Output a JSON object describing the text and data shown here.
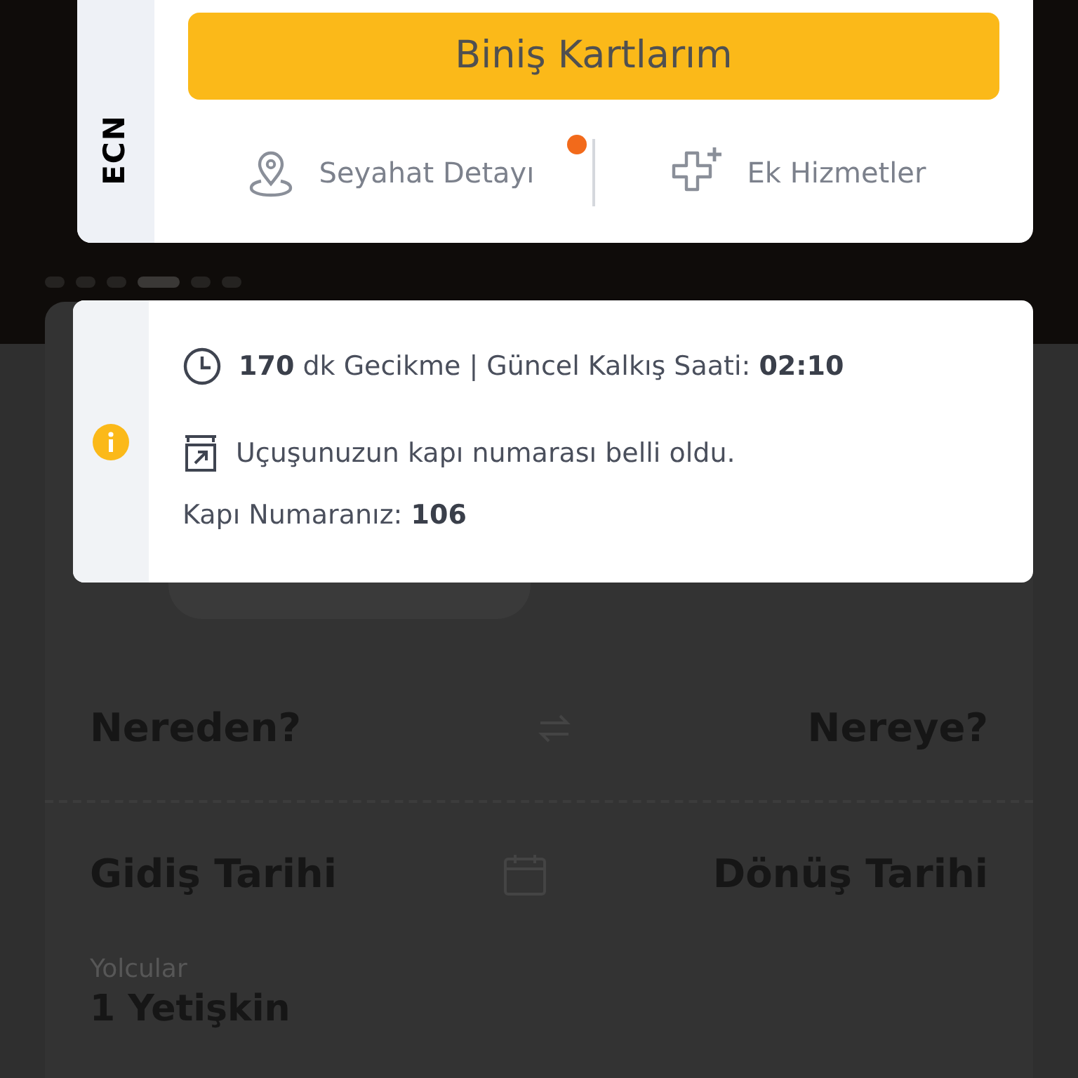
{
  "flight_card": {
    "cabin_code": "ECN",
    "primary_button": "Biniş Kartlarım",
    "links": [
      {
        "kind": "pin",
        "label": "Seyahat Detayı",
        "badge": true
      },
      {
        "kind": "plus",
        "label": "Ek Hizmetler",
        "badge": false
      }
    ]
  },
  "carousel_dots": [
    {
      "selected": false
    },
    {
      "selected": false
    },
    {
      "selected": false
    },
    {
      "selected": true
    },
    {
      "selected": false
    },
    {
      "selected": false
    }
  ],
  "notice": {
    "lines": [
      {
        "kind": "clock",
        "text": "**170** dk Gecikme | Güncel Kalkış Saati: **02:10**"
      },
      {
        "kind": "gate",
        "text": "Uçuşunuzun kapı numarası belli oldu."
      },
      {
        "kind": "plain",
        "text": "Kapı Numaranız: **106**"
      }
    ]
  },
  "search_form": {
    "from": "Nereden?",
    "to": "Nereye?",
    "departure_date": "Gidiş Tarihi",
    "return_date": "Dönüş Tarihi",
    "passengers_label": "Yolcular",
    "passengers_value": "1 Yetişkin"
  }
}
